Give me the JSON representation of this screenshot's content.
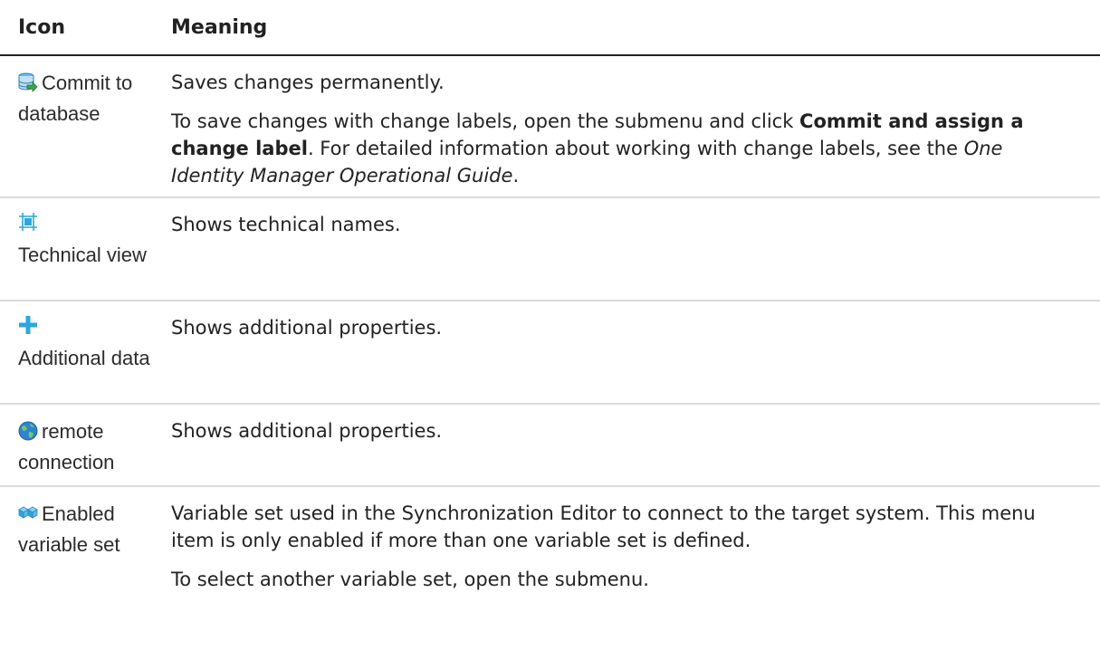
{
  "header": {
    "col_icon": "Icon",
    "col_meaning": "Meaning"
  },
  "rows": [
    {
      "icon": "database-commit-icon",
      "label": "Commit to database",
      "paragraphs": [
        {
          "text": "Saves changes permanently."
        },
        {
          "pre": "To save changes with change labels, open the submenu and click ",
          "bold": "Commit and assign a change label",
          "mid": ". For detailed information about working with change labels, see the ",
          "italic": "One Identity Manager Operational Guide",
          "post": "."
        }
      ]
    },
    {
      "icon": "technical-view-icon",
      "label": "Technical view",
      "paragraphs": [
        {
          "text": "Shows technical names."
        }
      ]
    },
    {
      "icon": "plus-icon",
      "label": "Additional data",
      "paragraphs": [
        {
          "text": "Shows additional properties."
        }
      ]
    },
    {
      "icon": "globe-icon",
      "label": "remote connection",
      "paragraphs": [
        {
          "text": "Shows additional properties."
        }
      ]
    },
    {
      "icon": "variable-set-icon",
      "label": "Enabled variable set",
      "paragraphs": [
        {
          "text": "Variable set used in the Synchronization Editor to connect to the target system. This menu item is only enabled if more than one variable set is defined."
        },
        {
          "text": "To select another variable set, open the submenu."
        }
      ]
    }
  ],
  "colors": {
    "icon_blue": "#2aa7df",
    "divider": "#dcdcdc",
    "header_rule": "#222222"
  }
}
